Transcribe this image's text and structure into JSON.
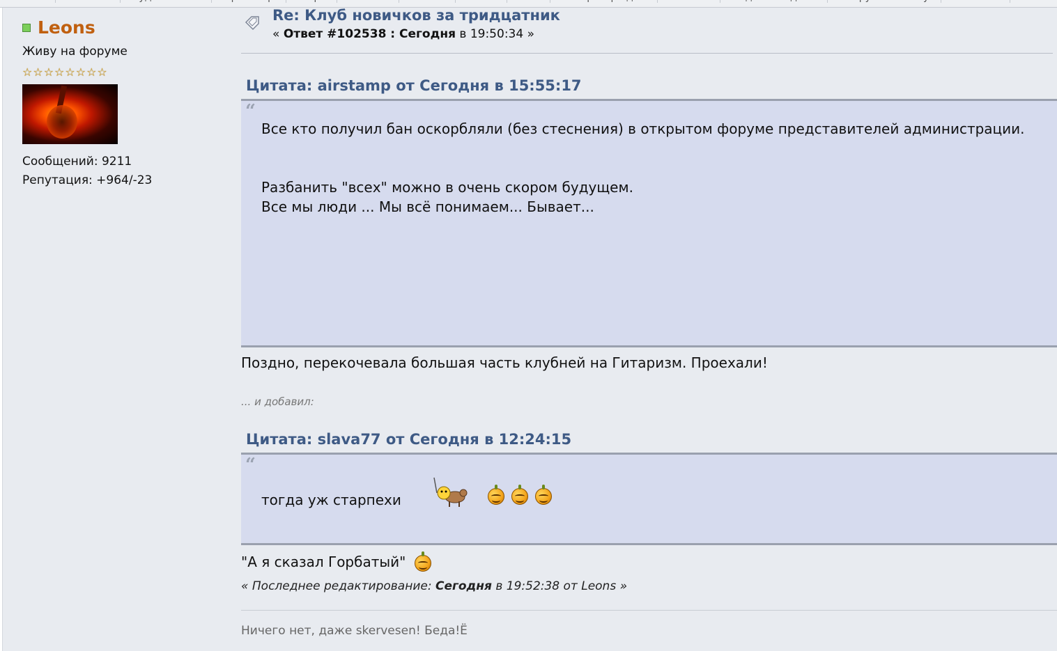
{
  "nav": {
    "items": [
      "Новое",
      "Чак-Чак",
      "Аудиозаписи",
      "Просмотр",
      "Софт",
      "Работы",
      "Копии",
      "Тимы",
      "Бон",
      "Генератор идей",
      "Чакоты",
      "Под итог ждали",
      "Петру Ивановичу",
      "Новинки"
    ]
  },
  "poster": {
    "name": "Leons",
    "title": "Живу на форуме",
    "stars": 8,
    "posts": "Сообщений: 9211",
    "reputation": "Репутация: +964/-23"
  },
  "post": {
    "subject": "Re: Клуб новичков за тридцатник",
    "meta_prefix": "« ",
    "meta_reply": "Ответ #102538 : Сегодня",
    "meta_time": " в 19:50:34 »"
  },
  "quote1": {
    "title": "Цитата: airstamp от Сегодня в 15:55:17",
    "line1": "Все кто получил бан оскорбляли (без стеснения) в открытом форуме представителей администрации.",
    "line2": "Разбанить \"всех\" можно в очень скором будущем.",
    "line3": "Все мы люди ... Мы всё понимаем... Бывает..."
  },
  "reply1": "Поздно, перекочевала большая часть клубней на Гитаризм. Проехали!",
  "added_label": "... и добавил:",
  "quote2": {
    "title": "Цитата: slava77 от Сегодня в 12:24:15",
    "text": "тогда уж старпехи"
  },
  "reply2": "\"А я сказал Горбатый\"",
  "edited": {
    "prefix": "« Последнее редактирование: ",
    "date": "Сегодня",
    "suffix": " в 19:52:38 от Leons »"
  },
  "signature": "Ничего нет, даже skervesen! Беда!Ё",
  "colors": {
    "accent": "#3e5a85",
    "poster_name": "#c06010",
    "quote_bg": "#d6dbee",
    "post_bg": "#e8ebf0"
  }
}
